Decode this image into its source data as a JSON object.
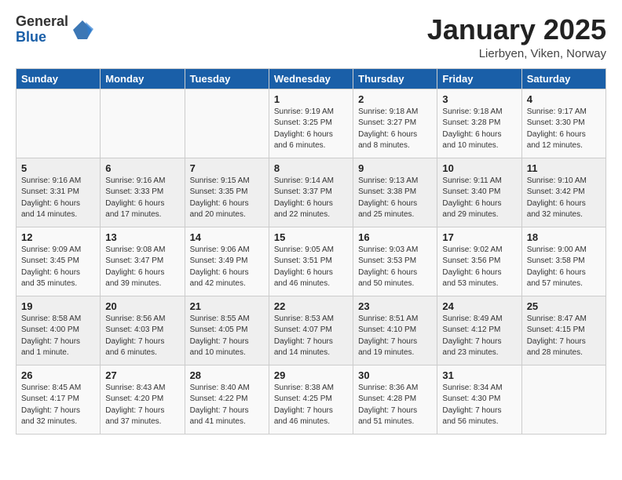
{
  "logo": {
    "general": "General",
    "blue": "Blue"
  },
  "header": {
    "title": "January 2025",
    "location": "Lierbyen, Viken, Norway"
  },
  "weekdays": [
    "Sunday",
    "Monday",
    "Tuesday",
    "Wednesday",
    "Thursday",
    "Friday",
    "Saturday"
  ],
  "weeks": [
    [
      {
        "day": "",
        "info": ""
      },
      {
        "day": "",
        "info": ""
      },
      {
        "day": "",
        "info": ""
      },
      {
        "day": "1",
        "info": "Sunrise: 9:19 AM\nSunset: 3:25 PM\nDaylight: 6 hours\nand 6 minutes."
      },
      {
        "day": "2",
        "info": "Sunrise: 9:18 AM\nSunset: 3:27 PM\nDaylight: 6 hours\nand 8 minutes."
      },
      {
        "day": "3",
        "info": "Sunrise: 9:18 AM\nSunset: 3:28 PM\nDaylight: 6 hours\nand 10 minutes."
      },
      {
        "day": "4",
        "info": "Sunrise: 9:17 AM\nSunset: 3:30 PM\nDaylight: 6 hours\nand 12 minutes."
      }
    ],
    [
      {
        "day": "5",
        "info": "Sunrise: 9:16 AM\nSunset: 3:31 PM\nDaylight: 6 hours\nand 14 minutes."
      },
      {
        "day": "6",
        "info": "Sunrise: 9:16 AM\nSunset: 3:33 PM\nDaylight: 6 hours\nand 17 minutes."
      },
      {
        "day": "7",
        "info": "Sunrise: 9:15 AM\nSunset: 3:35 PM\nDaylight: 6 hours\nand 20 minutes."
      },
      {
        "day": "8",
        "info": "Sunrise: 9:14 AM\nSunset: 3:37 PM\nDaylight: 6 hours\nand 22 minutes."
      },
      {
        "day": "9",
        "info": "Sunrise: 9:13 AM\nSunset: 3:38 PM\nDaylight: 6 hours\nand 25 minutes."
      },
      {
        "day": "10",
        "info": "Sunrise: 9:11 AM\nSunset: 3:40 PM\nDaylight: 6 hours\nand 29 minutes."
      },
      {
        "day": "11",
        "info": "Sunrise: 9:10 AM\nSunset: 3:42 PM\nDaylight: 6 hours\nand 32 minutes."
      }
    ],
    [
      {
        "day": "12",
        "info": "Sunrise: 9:09 AM\nSunset: 3:45 PM\nDaylight: 6 hours\nand 35 minutes."
      },
      {
        "day": "13",
        "info": "Sunrise: 9:08 AM\nSunset: 3:47 PM\nDaylight: 6 hours\nand 39 minutes."
      },
      {
        "day": "14",
        "info": "Sunrise: 9:06 AM\nSunset: 3:49 PM\nDaylight: 6 hours\nand 42 minutes."
      },
      {
        "day": "15",
        "info": "Sunrise: 9:05 AM\nSunset: 3:51 PM\nDaylight: 6 hours\nand 46 minutes."
      },
      {
        "day": "16",
        "info": "Sunrise: 9:03 AM\nSunset: 3:53 PM\nDaylight: 6 hours\nand 50 minutes."
      },
      {
        "day": "17",
        "info": "Sunrise: 9:02 AM\nSunset: 3:56 PM\nDaylight: 6 hours\nand 53 minutes."
      },
      {
        "day": "18",
        "info": "Sunrise: 9:00 AM\nSunset: 3:58 PM\nDaylight: 6 hours\nand 57 minutes."
      }
    ],
    [
      {
        "day": "19",
        "info": "Sunrise: 8:58 AM\nSunset: 4:00 PM\nDaylight: 7 hours\nand 1 minute."
      },
      {
        "day": "20",
        "info": "Sunrise: 8:56 AM\nSunset: 4:03 PM\nDaylight: 7 hours\nand 6 minutes."
      },
      {
        "day": "21",
        "info": "Sunrise: 8:55 AM\nSunset: 4:05 PM\nDaylight: 7 hours\nand 10 minutes."
      },
      {
        "day": "22",
        "info": "Sunrise: 8:53 AM\nSunset: 4:07 PM\nDaylight: 7 hours\nand 14 minutes."
      },
      {
        "day": "23",
        "info": "Sunrise: 8:51 AM\nSunset: 4:10 PM\nDaylight: 7 hours\nand 19 minutes."
      },
      {
        "day": "24",
        "info": "Sunrise: 8:49 AM\nSunset: 4:12 PM\nDaylight: 7 hours\nand 23 minutes."
      },
      {
        "day": "25",
        "info": "Sunrise: 8:47 AM\nSunset: 4:15 PM\nDaylight: 7 hours\nand 28 minutes."
      }
    ],
    [
      {
        "day": "26",
        "info": "Sunrise: 8:45 AM\nSunset: 4:17 PM\nDaylight: 7 hours\nand 32 minutes."
      },
      {
        "day": "27",
        "info": "Sunrise: 8:43 AM\nSunset: 4:20 PM\nDaylight: 7 hours\nand 37 minutes."
      },
      {
        "day": "28",
        "info": "Sunrise: 8:40 AM\nSunset: 4:22 PM\nDaylight: 7 hours\nand 41 minutes."
      },
      {
        "day": "29",
        "info": "Sunrise: 8:38 AM\nSunset: 4:25 PM\nDaylight: 7 hours\nand 46 minutes."
      },
      {
        "day": "30",
        "info": "Sunrise: 8:36 AM\nSunset: 4:28 PM\nDaylight: 7 hours\nand 51 minutes."
      },
      {
        "day": "31",
        "info": "Sunrise: 8:34 AM\nSunset: 4:30 PM\nDaylight: 7 hours\nand 56 minutes."
      },
      {
        "day": "",
        "info": ""
      }
    ]
  ]
}
